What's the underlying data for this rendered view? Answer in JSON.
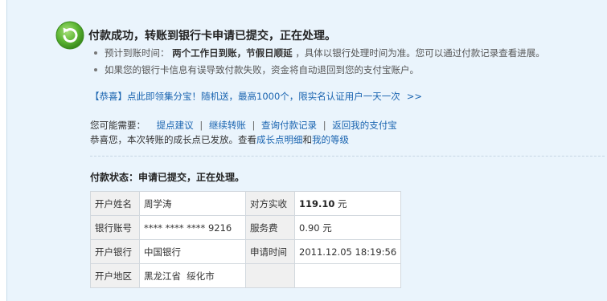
{
  "header": {
    "title": "付款成功，转账到银行卡申请已提交，正在处理。"
  },
  "bullets": {
    "arrival_label": "预计到账时间：",
    "arrival_value": "两个工作日到账，节假日顺延",
    "arrival_note": "，具体以银行处理时间为准。您可以通过付款记录查看进展。",
    "failure_note": "如果您的银行卡信息有误导致付款失败，资金将自动退回到您的支付宝账户。"
  },
  "promo": {
    "text": "【恭喜】点此即领集分宝！随机送，最高1000个，限实名认证用户一天一次",
    "arrows": ">>"
  },
  "needs": {
    "label": "您可能需要：",
    "links": [
      "提点建议",
      "继续转账",
      "查询付款记录",
      "返回我的支付宝"
    ],
    "separator": "|"
  },
  "growth": {
    "text_before": "恭喜您，本次转账的成长点已发放。查看",
    "link1": "成长点明细",
    "conj": "和",
    "link2": "我的等级"
  },
  "status": {
    "text": "付款状态：申请已提交，正在处理。"
  },
  "details": {
    "rows": [
      {
        "k1": "开户姓名",
        "v1": "周学涛",
        "k2": "对方实收",
        "v2_amount": "119.10",
        "v2_unit": " 元"
      },
      {
        "k1": "银行账号",
        "v1": "**** **** **** 9216",
        "k2": "服务费",
        "v2": "0.90 元"
      },
      {
        "k1": "开户银行",
        "v1": "中国银行",
        "k2": "申请时间",
        "v2": "2011.12.05 18:19:56"
      },
      {
        "k1": "开户地区",
        "v1": "黑龙江省  绥化市"
      }
    ]
  },
  "colors": {
    "panel_bg": "#eaf4fc",
    "link": "#1a64b0",
    "success_green": "#4fa82a"
  }
}
